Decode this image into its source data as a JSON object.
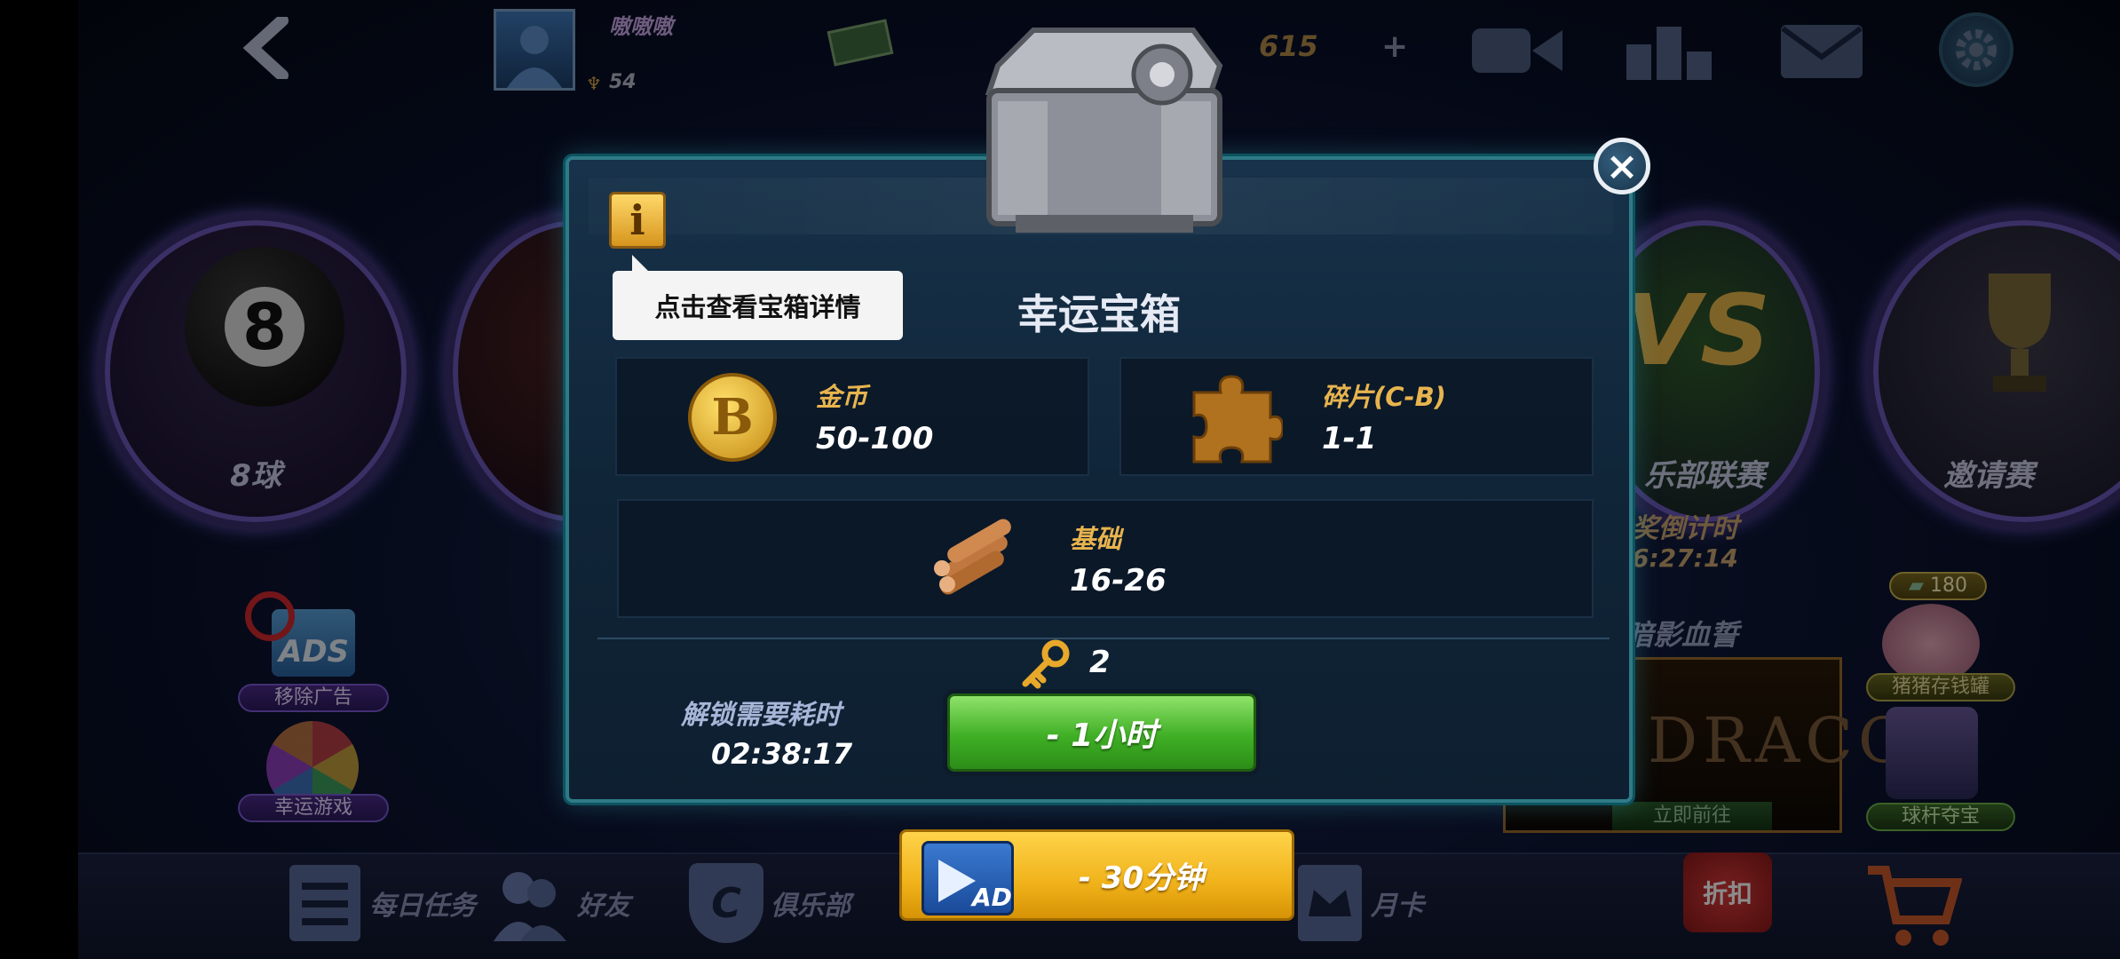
{
  "topbar": {
    "back": "back",
    "player_name": "嗷嗷嗷",
    "trophies": "54",
    "coins": "615",
    "add": "+"
  },
  "modes": {
    "left": "8球",
    "right_vs": "乐部联赛",
    "right_invite": "邀请赛",
    "countdown_label": "奖倒计时",
    "countdown_value": "6:27:14",
    "event_title": "暗影血誓",
    "event_logo": "DRACON",
    "event_go": "立即前往"
  },
  "side": {
    "remove_ads": "移除广告",
    "ads_icon_text": "ADS",
    "lucky_game": "幸运游戏",
    "piggy_value": "180",
    "piggy_label": "猪猪存钱罐",
    "cue_label": "球杆夺宝"
  },
  "bottom_nav": {
    "daily": "每日任务",
    "friends": "好友",
    "club": "俱乐部",
    "club_badge": "C",
    "monthly": "月卡",
    "discount": "折扣"
  },
  "modal": {
    "title": "幸运宝箱",
    "tooltip": "点击查看宝箱详情",
    "info": "i",
    "close": "×",
    "rewards": [
      {
        "label": "金币",
        "value": "50-100",
        "icon": "gold-coin-icon"
      },
      {
        "label": "碎片(C-B)",
        "value": "1-1",
        "icon": "puzzle-piece-icon"
      },
      {
        "label": "基础",
        "value": "16-26",
        "icon": "wood-logs-icon"
      }
    ],
    "keys": "2",
    "unlock_label": "解锁需要耗时",
    "unlock_time": "02:38:17",
    "unlock_button": "- 1小时",
    "ad_button": "- 30分钟",
    "ad_icon_text": "AD"
  },
  "colors": {
    "accent_gold": "#e8b44e",
    "green_button": "#3faf25",
    "yellow_button": "#f0b21a",
    "modal_border": "#2f7a86"
  }
}
